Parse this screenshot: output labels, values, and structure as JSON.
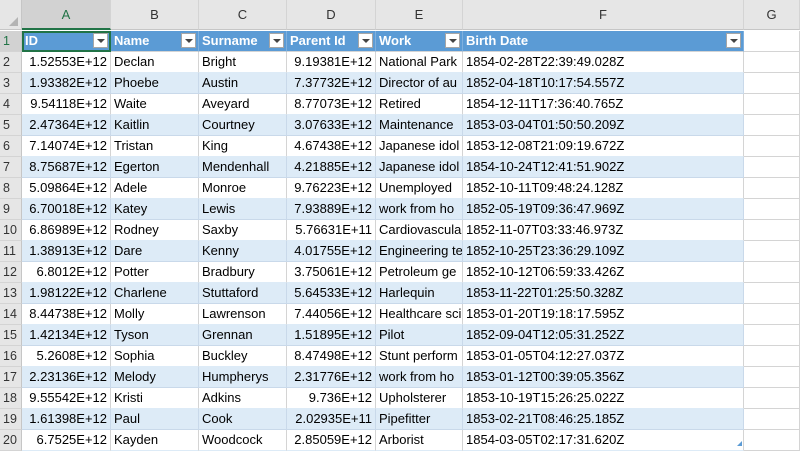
{
  "columns": [
    "A",
    "B",
    "C",
    "D",
    "E",
    "F",
    "G"
  ],
  "row_numbers": [
    "1",
    "2",
    "3",
    "4",
    "5",
    "6",
    "7",
    "8",
    "9",
    "10",
    "11",
    "12",
    "13",
    "14",
    "15",
    "16",
    "17",
    "18",
    "19",
    "20"
  ],
  "table": {
    "headers": [
      "ID",
      "Name",
      "Surname",
      "Parent Id",
      "Work",
      "Birth Date"
    ],
    "rows": [
      [
        "1.52553E+12",
        "Declan",
        "Bright",
        "9.19381E+12",
        "National Park",
        "1854-02-28T22:39:49.028Z"
      ],
      [
        "1.93382E+12",
        "Phoebe",
        "Austin",
        "7.37732E+12",
        "Director of au",
        "1852-04-18T10:17:54.557Z"
      ],
      [
        "9.54118E+12",
        "Waite",
        "Aveyard",
        "8.77073E+12",
        "Retired",
        "1854-12-11T17:36:40.765Z"
      ],
      [
        "2.47364E+12",
        "Kaitlin",
        "Courtney",
        "3.07633E+12",
        "Maintenance",
        "1853-03-04T01:50:50.209Z"
      ],
      [
        "7.14074E+12",
        "Tristan",
        "King",
        "4.67438E+12",
        "Japanese idol",
        "1853-12-08T21:09:19.672Z"
      ],
      [
        "8.75687E+12",
        "Egerton",
        "Mendenhall",
        "4.21885E+12",
        "Japanese idol",
        "1854-10-24T12:41:51.902Z"
      ],
      [
        "5.09864E+12",
        "Adele",
        "Monroe",
        "9.76223E+12",
        "Unemployed",
        "1852-10-11T09:48:24.128Z"
      ],
      [
        "6.70018E+12",
        "Katey",
        "Lewis",
        "7.93889E+12",
        "work from ho",
        "1852-05-19T09:36:47.969Z"
      ],
      [
        "6.86989E+12",
        "Rodney",
        "Saxby",
        "5.76631E+11",
        "Cardiovascula",
        "1852-11-07T03:33:46.973Z"
      ],
      [
        "1.38913E+12",
        "Dare",
        "Kenny",
        "4.01755E+12",
        "Engineering te",
        "1852-10-25T23:36:29.109Z"
      ],
      [
        "6.8012E+12",
        "Potter",
        "Bradbury",
        "3.75061E+12",
        "Petroleum ge",
        "1852-10-12T06:59:33.426Z"
      ],
      [
        "1.98122E+12",
        "Charlene",
        "Stuttaford",
        "5.64533E+12",
        "Harlequin",
        "1853-11-22T01:25:50.328Z"
      ],
      [
        "8.44738E+12",
        "Molly",
        "Lawrenson",
        "7.44056E+12",
        "Healthcare sci",
        "1853-01-20T19:18:17.595Z"
      ],
      [
        "1.42134E+12",
        "Tyson",
        "Grennan",
        "1.51895E+12",
        "Pilot",
        "1852-09-04T12:05:31.252Z"
      ],
      [
        "5.2608E+12",
        "Sophia",
        "Buckley",
        "8.47498E+12",
        "Stunt perform",
        "1853-01-05T04:12:27.037Z"
      ],
      [
        "2.23136E+12",
        "Melody",
        "Humpherys",
        "2.31776E+12",
        "work from ho",
        "1853-01-12T00:39:05.356Z"
      ],
      [
        "9.55542E+12",
        "Kristi",
        "Adkins",
        "9.736E+12",
        "Upholsterer",
        "1853-10-19T15:26:25.022Z"
      ],
      [
        "1.61398E+12",
        "Paul",
        "Cook",
        "2.02935E+11",
        "Pipefitter",
        "1853-02-21T08:46:25.185Z"
      ],
      [
        "6.7525E+12",
        "Kayden",
        "Woodcock",
        "2.85059E+12",
        "Arborist",
        "1854-03-05T02:17:31.620Z"
      ]
    ]
  },
  "colors": {
    "table_header": "#5b9bd5",
    "band": "#ddebf7",
    "selection": "#217346",
    "grid_header": "#e6e6e6"
  },
  "active_cell": "A1",
  "icons": {
    "filter": "filter-dropdown-icon",
    "corner": "select-all-triangle-icon",
    "resize": "table-resize-handle-icon"
  }
}
